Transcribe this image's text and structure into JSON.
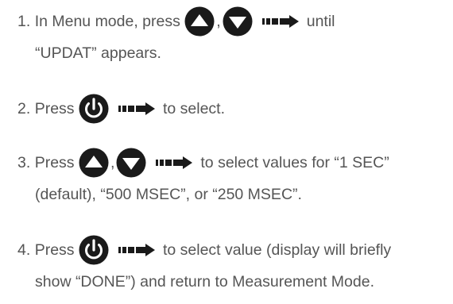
{
  "steps": [
    {
      "number": "1.",
      "line1_prefix": "In Menu mode, press",
      "line1_comma": ",",
      "line1_suffix": "until",
      "line2": "“UPDAT” appears.",
      "icons": [
        "up-button-icon",
        "down-button-icon",
        "arrow-right-icon"
      ]
    },
    {
      "number": "2.",
      "line1_prefix": "Press",
      "line1_suffix": "to select.",
      "icons": [
        "power-button-icon",
        "arrow-right-icon"
      ]
    },
    {
      "number": "3.",
      "line1_prefix": "Press",
      "line1_comma": ",",
      "line1_suffix": "to select values for “1 SEC”",
      "line2": "(default), “500 MSEC”, or “250 MSEC”.",
      "icons": [
        "up-button-icon",
        "down-button-icon",
        "arrow-right-icon"
      ]
    },
    {
      "number": "4.",
      "line1_prefix": "Press",
      "line1_suffix": "to select value (display will briefly",
      "line2": "show “DONE”) and return to Measurement Mode.",
      "icons": [
        "power-button-icon",
        "arrow-right-icon"
      ]
    }
  ],
  "colors": {
    "text": "#555555",
    "icon": "#1a1a1a"
  }
}
